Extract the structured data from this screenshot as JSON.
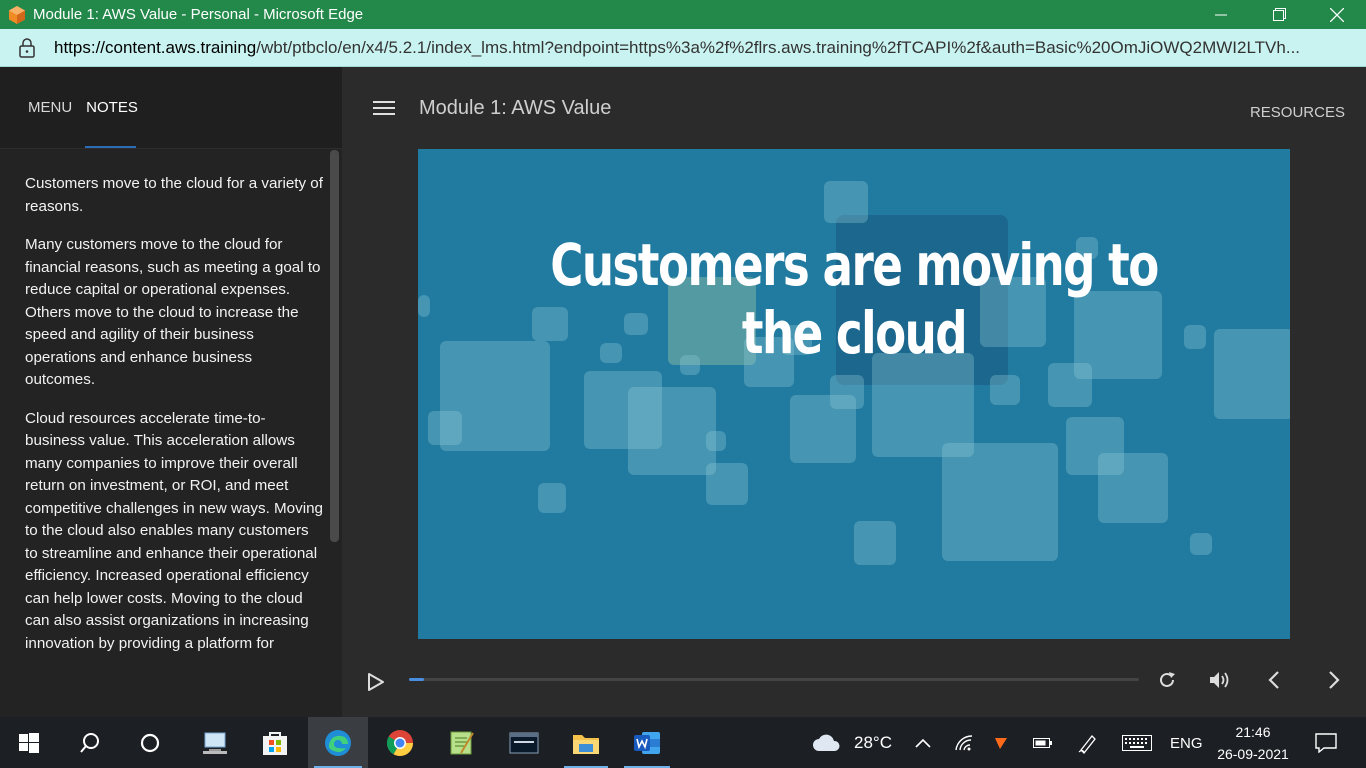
{
  "window": {
    "title": "Module 1: AWS Value - Personal - Microsoft Edge"
  },
  "address_bar": {
    "host": "https://content.aws.training",
    "rest": "/wbt/ptbclo/en/x4/5.2.1/index_lms.html?endpoint=https%3a%2f%2flrs.aws.training%2fTCAPI%2f&auth=Basic%20OmJiOWQ2MWI2LTVh..."
  },
  "sidebar": {
    "tabs": [
      {
        "label": "MENU"
      },
      {
        "label": "NOTES"
      }
    ],
    "notes": [
      "Customers move to the cloud for a variety of reasons.",
      "Many customers move to the cloud for financial reasons, such as meeting a goal to reduce capital or operational expenses. Others move to the cloud to increase the speed and agility of their business operations and enhance business outcomes.",
      "Cloud resources accelerate time-to-business value. This acceleration allows many companies to improve their overall return on investment, or ROI, and meet competitive challenges in new ways. Moving to the cloud also enables many customers to streamline and enhance their operational efficiency. Increased operational efficiency can help lower costs. Moving to the cloud can also assist organizations in increasing innovation by providing a platform for"
    ]
  },
  "player": {
    "module_title": "Module 1: AWS Value",
    "resources_label": "RESOURCES",
    "slide_headline": "Customers are moving to the cloud",
    "progress_fraction": 0.02,
    "colors": {
      "slide_bg": "#217a9f",
      "progress": "#4a8de0"
    }
  },
  "taskbar": {
    "apps": [
      "start-icon",
      "search-icon",
      "cortana-icon",
      "network-pc-icon",
      "store-icon",
      "edge-icon",
      "chrome-icon",
      "notepad-icon",
      "mysql-icon",
      "file-explorer-icon",
      "word-icon"
    ],
    "weather": "28°C",
    "language": "ENG",
    "time": "21:46",
    "date": "26-09-2021"
  }
}
